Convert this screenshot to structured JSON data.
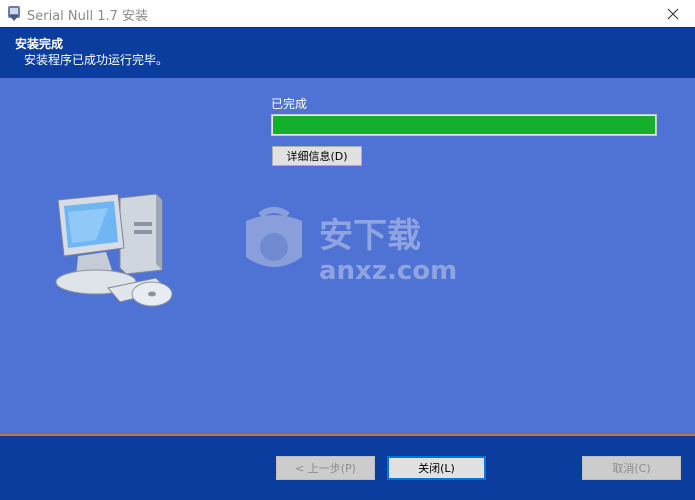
{
  "window": {
    "title": "Serial Null 1.7 安装"
  },
  "header": {
    "title": "安装完成",
    "subtitle": "安装程序已成功运行完毕。"
  },
  "main": {
    "status_label": "已完成",
    "progress_percent": 100,
    "details_button": "详细信息(D)"
  },
  "watermark": {
    "cn_text": "安下载",
    "url_text": "anxz.com"
  },
  "footer": {
    "back_button": "< 上一步(P)",
    "close_button": "关闭(L)",
    "cancel_button": "取消(C)"
  },
  "colors": {
    "header_bg": "#0a3d9e",
    "main_bg": "#4f73d4",
    "progress_fill": "#13b02c"
  }
}
